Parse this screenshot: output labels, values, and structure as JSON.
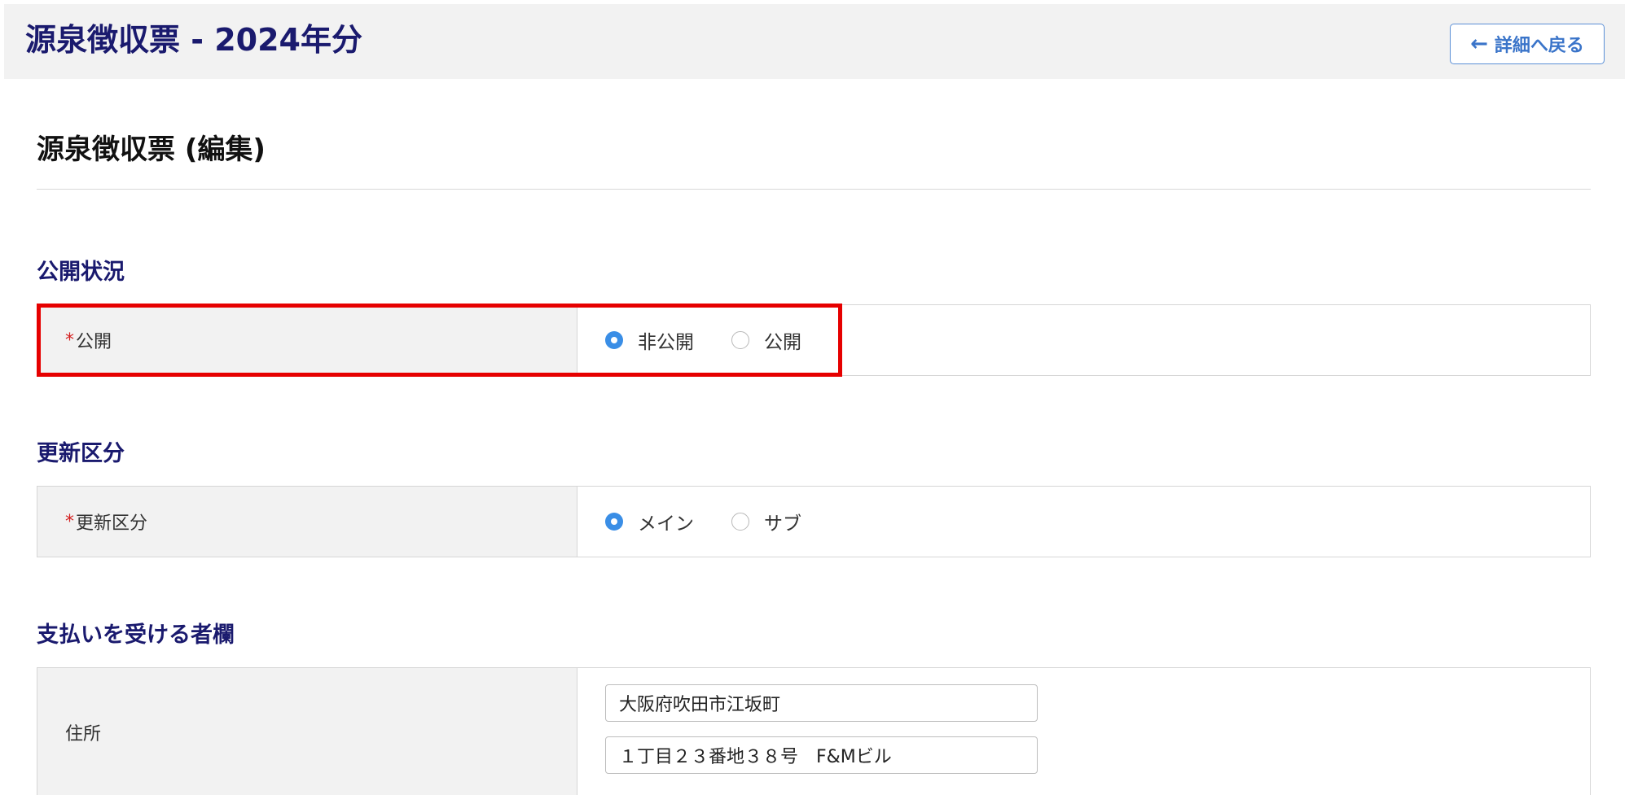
{
  "header": {
    "title": "源泉徴収票 - 2024年分",
    "back_button_label": "詳細へ戻る"
  },
  "page_title": "源泉徴収票 (編集)",
  "sections": {
    "visibility": {
      "title": "公開状況",
      "field_label": "公開",
      "required_mark": "*",
      "options": [
        "非公開",
        "公開"
      ],
      "selected": "非公開"
    },
    "update_type": {
      "title": "更新区分",
      "field_label": "更新区分",
      "required_mark": "*",
      "options": [
        "メイン",
        "サブ"
      ],
      "selected": "メイン"
    },
    "recipient": {
      "title": "支払いを受ける者欄",
      "address_label": "住所",
      "address_line1": "大阪府吹田市江坂町",
      "address_line2": "１丁目２３番地３８号　F&Mビル"
    }
  },
  "colors": {
    "accent": "#3a8ee6",
    "heading": "#1a1a6e",
    "highlight": "#e60000",
    "required": "#d42020"
  }
}
